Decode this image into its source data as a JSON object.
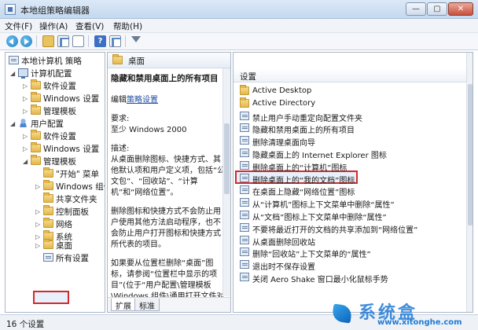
{
  "window": {
    "title": "本地组策略编辑器",
    "buttons": {
      "minimize": "—",
      "maximize": "▢",
      "close": "✕"
    }
  },
  "menu": [
    "文件(F)",
    "操作(A)",
    "查看(V)",
    "帮助(H)"
  ],
  "toolbar_icons": [
    "back-icon",
    "forward-icon",
    "up-folder-icon",
    "show-hide-tree-icon",
    "properties-icon",
    "help-icon",
    "export-list-icon",
    "filter-icon"
  ],
  "tree": [
    {
      "label": "本地计算机 策略",
      "icon": "policy"
    },
    {
      "label": "计算机配置",
      "icon": "pc"
    },
    {
      "label": "软件设置",
      "icon": "folder"
    },
    {
      "label": "Windows 设置",
      "icon": "folder"
    },
    {
      "label": "管理模板",
      "icon": "folder"
    },
    {
      "label": "用户配置",
      "icon": "user"
    },
    {
      "label": "软件设置",
      "icon": "folder"
    },
    {
      "label": "Windows 设置",
      "icon": "folder"
    },
    {
      "label": "管理模板",
      "icon": "folder"
    },
    {
      "label": "\"开始\" 菜单",
      "icon": "folder"
    },
    {
      "label": "Windows 组件",
      "icon": "folder"
    },
    {
      "label": "共享文件夹",
      "icon": "folder"
    },
    {
      "label": "控制面板",
      "icon": "folder"
    },
    {
      "label": "网络",
      "icon": "folder"
    },
    {
      "label": "系统",
      "icon": "folder"
    },
    {
      "label": "桌面",
      "icon": "folder",
      "selected": true
    },
    {
      "label": "所有设置",
      "icon": "policy"
    }
  ],
  "middle": {
    "header": "桌面",
    "title": "隐藏和禁用桌面上的所有项目",
    "edit_prefix": "编辑",
    "edit_link": "策略设置",
    "requirements_label": "要求:",
    "requirements_value": "至少 Windows 2000",
    "description_label": "描述:",
    "desc1": "从桌面删除图标、快捷方式、其他默认项和用户定义项，包括“公文包”、“回收站”、“计算机”和“网络位置”。",
    "desc2": "删除图标和快捷方式不会防止用户使用其他方法启动程序，也不会防止用户打开图标和快捷方式所代表的项目。",
    "desc3": "如果要从位置栏删除“桌面”图标，请参阅“位置栏中显示的项目”(位于“用户配置\\管理模板\\Windows 组件\\通用打开文件对",
    "tabs": [
      "扩展",
      "标准"
    ]
  },
  "right": {
    "column_header": "设置",
    "items": [
      {
        "label": "Active Desktop",
        "icon": "folder"
      },
      {
        "label": "Active Directory",
        "icon": "folder"
      },
      {
        "label": "禁止用户手动重定向配置文件夹",
        "icon": "policy"
      },
      {
        "label": "隐藏和禁用桌面上的所有项目",
        "icon": "policy",
        "selected": true
      },
      {
        "label": "删除清理桌面向导",
        "icon": "policy"
      },
      {
        "label": "隐藏桌面上的 Internet Explorer 图标",
        "icon": "policy"
      },
      {
        "label": "删除桌面上的“计算机”图标",
        "icon": "policy"
      },
      {
        "label": "删除桌面上的“我的文档”图标",
        "icon": "policy"
      },
      {
        "label": "在桌面上隐藏“网络位置”图标",
        "icon": "policy"
      },
      {
        "label": "从“计算机”图标上下文菜单中删除“属性”",
        "icon": "policy"
      },
      {
        "label": "从“文档”图标上下文菜单中删除“属性”",
        "icon": "policy"
      },
      {
        "label": "不要将最近打开的文档的共享添加到“网络位置”",
        "icon": "policy"
      },
      {
        "label": "从桌面删除回收站",
        "icon": "policy"
      },
      {
        "label": "删除“回收站”上下文菜单的“属性”",
        "icon": "policy"
      },
      {
        "label": "退出时不保存设置",
        "icon": "policy"
      },
      {
        "label": "关闭 Aero Shake 窗口最小化鼠标手势",
        "icon": "policy"
      }
    ]
  },
  "status": "16 个设置",
  "watermark": {
    "text": "系统盒",
    "url": "www.xitonghe.com"
  }
}
